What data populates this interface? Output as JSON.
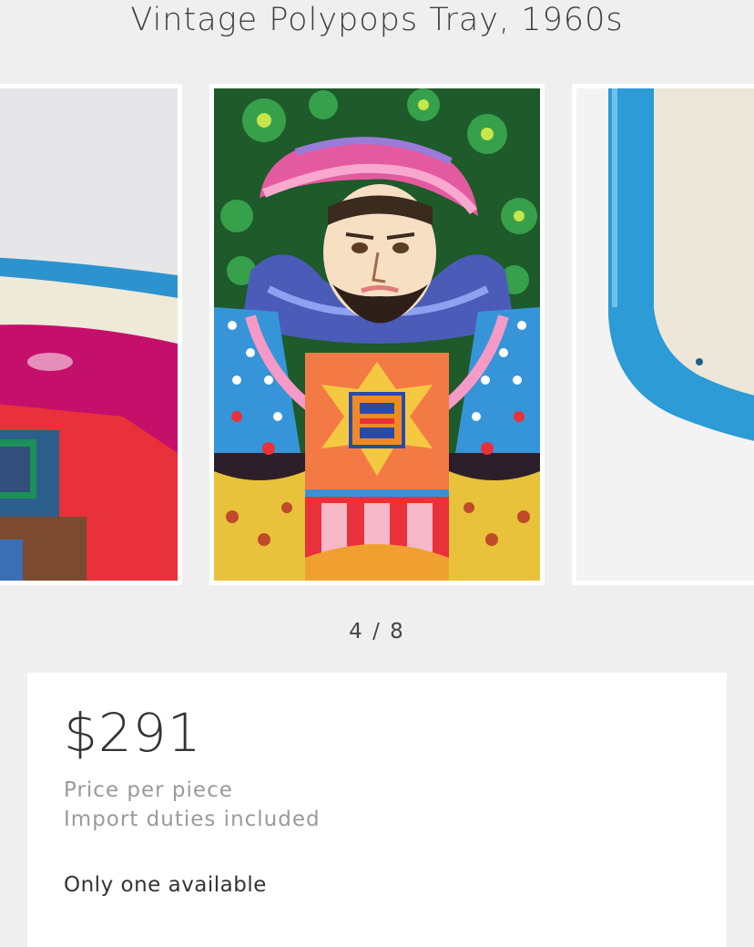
{
  "product": {
    "title": "Vintage Polypops Tray, 1960s"
  },
  "gallery": {
    "current": 4,
    "total": 8,
    "counter_text": "4 / 8",
    "slides": [
      {
        "role": "previous",
        "subject": "tray-detail-red-pink"
      },
      {
        "role": "current",
        "subject": "tray-king-illustration"
      },
      {
        "role": "next",
        "subject": "tray-blue-rim-detail"
      }
    ]
  },
  "pricing": {
    "price": "$291",
    "note_line1": "Price per piece",
    "note_line2": "Import duties included",
    "availability": "Only one available"
  },
  "colors": {
    "background": "#efefef",
    "card": "#ffffff",
    "text": "#333333",
    "muted": "#9a9a9a"
  }
}
